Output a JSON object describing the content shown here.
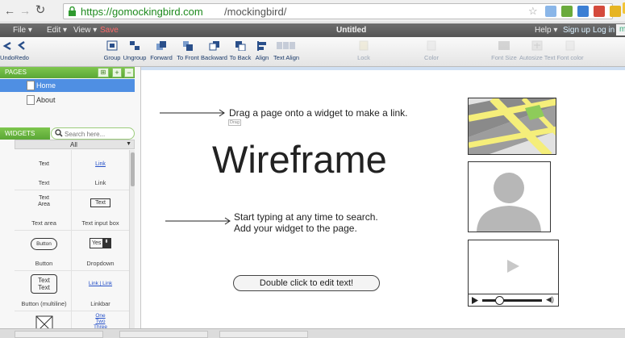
{
  "browser": {
    "url_host": "https://gomockingbird.com",
    "url_path": "/mockingbird/"
  },
  "menu": {
    "file": "File ▾",
    "edit": "Edit ▾",
    "view": "View ▾",
    "save": "Save",
    "doc_title": "Untitled",
    "help": "Help ▾",
    "signup": "Sign up",
    "login": "Log in",
    "cut_off": "m"
  },
  "toolbar": {
    "undo": "Undo",
    "redo": "Redo",
    "group": "Group",
    "ungroup": "Ungroup",
    "forward": "Forward",
    "to_front": "To Front",
    "backward": "Backward",
    "to_back": "To Back",
    "align": "Align",
    "text_align": "Text Align",
    "lock": "Lock",
    "color": "Color",
    "font_size": "Font Size",
    "autosize_text": "Autosize Text",
    "font_color": "Font color"
  },
  "pages_panel": {
    "title": "PAGES",
    "add": "+",
    "remove": "−",
    "items": [
      {
        "label": "Home"
      },
      {
        "label": "About"
      }
    ]
  },
  "widgets_panel": {
    "title": "WIDGETS",
    "search_placeholder": "Search here...",
    "filter": "All",
    "items": [
      {
        "preview": "Text",
        "name": "Text"
      },
      {
        "preview": "Link",
        "name": "Link"
      },
      {
        "preview": "Text Area",
        "name": "Text area"
      },
      {
        "preview": "Text",
        "name": "Text input box"
      },
      {
        "preview": "Button",
        "name": "Button"
      },
      {
        "preview": "Yes",
        "name": "Dropdown"
      },
      {
        "preview": "Text Text",
        "name": "Button (multiline)"
      },
      {
        "preview": "Link | Link",
        "name": "Linkbar"
      },
      {
        "preview": "",
        "name": ""
      },
      {
        "preview": "One Two Three",
        "name": ""
      }
    ]
  },
  "canvas": {
    "annotation1": "Drag a page onto a widget to make a link.",
    "annotation1_badge": "Drag",
    "heading": "Wireframe",
    "annotation2_line1": "Start typing at any time to search.",
    "annotation2_line2": "Add your widget to the page.",
    "button_label": "Double click to edit text!"
  },
  "colors": {
    "accent_green": "#6cb843",
    "selected_blue": "#4f8fe3",
    "menubar_gray": "#5e5e5e",
    "map_yellow": "#f5ee7a",
    "link_blue": "#2550c8"
  }
}
